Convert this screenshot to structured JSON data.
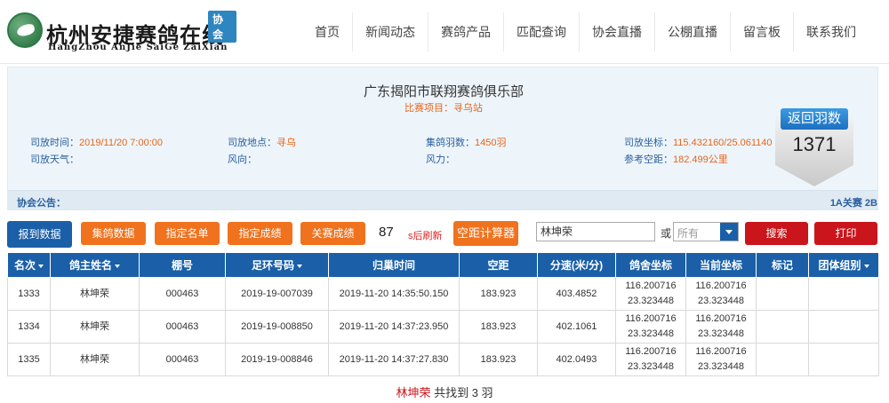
{
  "site": {
    "title_cn": "杭州安捷赛鸽在线",
    "title_en": "HangZhou AnJie SaiGe ZaiXian",
    "badge": "协会",
    "nav": [
      "首页",
      "新闻动态",
      "赛鸽产品",
      "匹配查询",
      "协会直播",
      "公棚直播",
      "留言板",
      "联系我们"
    ]
  },
  "race": {
    "club": "广东揭阳市联翔赛鸽俱乐部",
    "project": "比赛项目：寻乌站",
    "release_time_label": "司放时间：",
    "release_time": "2019/11/20 7:00:00",
    "weather_label": "司放天气：",
    "release_place_label": "司放地点：",
    "release_place": "寻乌",
    "wind_dir_label": "风向：",
    "collected_label": "集鸽羽数：",
    "collected": "1450羽",
    "wind_force_label": "风力：",
    "coord_label": "司放坐标：",
    "coord": "115.432160/25.061140",
    "distance_label": "参考空距：",
    "distance": "182.499公里",
    "notice_label": "协会公告：",
    "notice_scroll": "1A关赛 2B"
  },
  "returns": {
    "label": "返回羽数",
    "count": "1371"
  },
  "toolbar": {
    "report_data": "报到数据",
    "collect_data": "集鸽数据",
    "designated_list": "指定名单",
    "designated_results": "指定成绩",
    "final_results": "关赛成绩",
    "countdown": "87",
    "refresh_text": "s后刷新",
    "distance_calc": "空距计算器",
    "search_value": "林坤荣",
    "or_text": "或",
    "select_value": "所有",
    "search_button": "搜索",
    "print_button": "打印"
  },
  "table": {
    "headers": [
      "名次",
      "鸽主姓名",
      "棚号",
      "足环号码",
      "归巢时间",
      "空距",
      "分速(米/分)",
      "鸽舍坐标",
      "当前坐标",
      "标记",
      "团体组别"
    ],
    "sortable": [
      true,
      true,
      false,
      true,
      false,
      false,
      false,
      false,
      false,
      false,
      true
    ],
    "rows": [
      [
        "1333",
        "林坤荣",
        "000463",
        "2019-19-007039",
        "2019-11-20 14:35:50.150",
        "183.923",
        "403.4852",
        "116.200716",
        "23.323448",
        "116.200716",
        "23.323448",
        "",
        ""
      ],
      [
        "1334",
        "林坤荣",
        "000463",
        "2019-19-008850",
        "2019-11-20 14:37:23.950",
        "183.923",
        "402.1061",
        "116.200716",
        "23.323448",
        "116.200716",
        "23.323448",
        "",
        ""
      ],
      [
        "1335",
        "林坤荣",
        "000463",
        "2019-19-008846",
        "2019-11-20 14:37:27.830",
        "183.923",
        "402.0493",
        "116.200716",
        "23.323448",
        "116.200716",
        "23.323448",
        "",
        ""
      ]
    ]
  },
  "footer": {
    "name": "林坤荣",
    "text": " 共找到 3 羽"
  }
}
